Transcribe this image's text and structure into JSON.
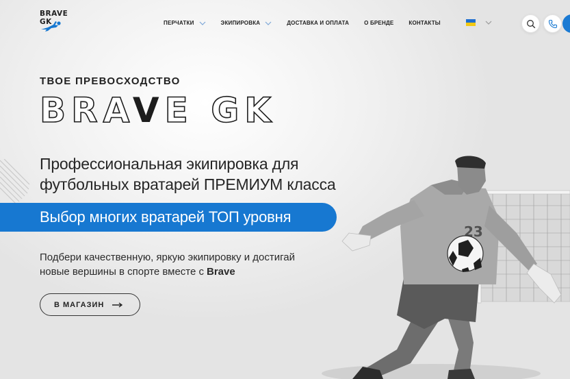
{
  "header": {
    "logo_text": "BRAVE GK",
    "nav": [
      {
        "label": "ПЕРЧАТКИ",
        "dropdown": true
      },
      {
        "label": "ЭКИПИРОВКА",
        "dropdown": true
      },
      {
        "label": "ДОСТАВКА И ОПЛАТА",
        "dropdown": false
      },
      {
        "label": "О БРЕНДЕ",
        "dropdown": false
      },
      {
        "label": "КОНТАКТЫ",
        "dropdown": false
      }
    ],
    "language_icon": "ukraine-flag-icon",
    "search_icon": "search-icon",
    "phone_icon": "phone-icon"
  },
  "hero": {
    "kicker": "ТВОЕ ПРЕВОСХОДСТВО",
    "brand_left": "BRA",
    "brand_accent": "V",
    "brand_right": "E GK",
    "headline_line1": "Профессиональная экипировка для",
    "headline_line2": "футбольных вратарей ПРЕМИУМ класса",
    "banner": "Выбор многих вратарей ТОП уровня",
    "subtext_line1": "Подбери качественную, яркую экипировку и достигай",
    "subtext_line2": "новые вершины в спорте вместе с",
    "subtext_brand": "Brave",
    "cta_label": "В МАГАЗИН",
    "player_number": "23"
  },
  "colors": {
    "accent": "#1778d1",
    "text": "#1d1d1d",
    "background": "#f1f1f1"
  }
}
